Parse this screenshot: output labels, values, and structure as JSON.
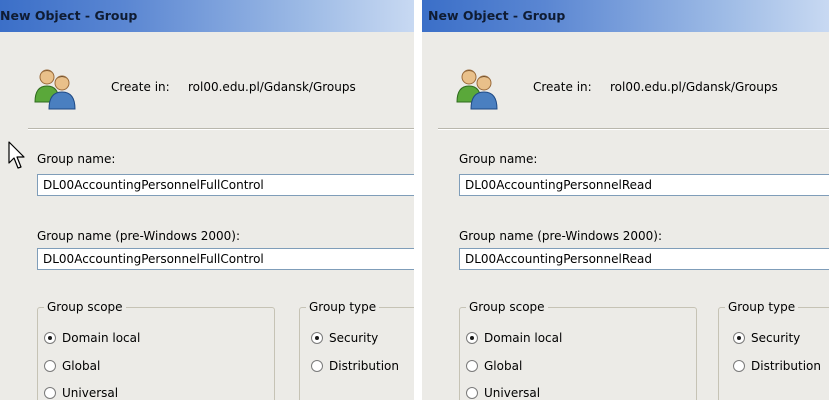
{
  "dialogs": [
    {
      "title": "New Object - Group",
      "create_in_label": "Create in:",
      "create_in_path": "rol00.edu.pl/Gdansk/Groups",
      "group_name_label": "Group name:",
      "group_name_value": "DL00AccountingPersonnelFullControl",
      "pre2000_label": "Group name (pre-Windows 2000):",
      "pre2000_value": "DL00AccountingPersonnelFullControl",
      "scope_title": "Group scope",
      "scope_options": [
        "Domain local",
        "Global",
        "Universal"
      ],
      "scope_selected": "Domain local",
      "type_title": "Group type",
      "type_options": [
        "Security",
        "Distribution"
      ],
      "type_selected": "Security"
    },
    {
      "title": "New Object - Group",
      "create_in_label": "Create in:",
      "create_in_path": "rol00.edu.pl/Gdansk/Groups",
      "group_name_label": "Group name:",
      "group_name_value": "DL00AccountingPersonnelRead",
      "pre2000_label": "Group name (pre-Windows 2000):",
      "pre2000_value": "DL00AccountingPersonnelRead",
      "scope_title": "Group scope",
      "scope_options": [
        "Domain local",
        "Global",
        "Universal"
      ],
      "scope_selected": "Domain local",
      "type_title": "Group type",
      "type_options": [
        "Security",
        "Distribution"
      ],
      "type_selected": "Security"
    }
  ],
  "icons": {
    "group": "group-icon",
    "cursor": "mouse-pointer-icon"
  }
}
